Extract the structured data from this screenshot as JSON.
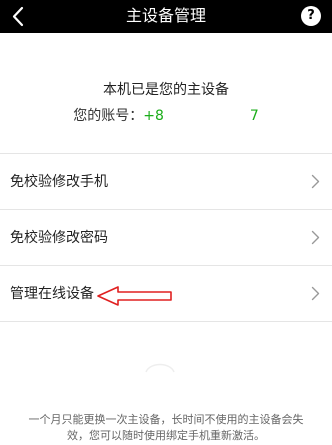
{
  "topbar": {
    "title": "主设备管理",
    "back_icon": "chevron-left-icon",
    "help_label": "?",
    "background": "#000000"
  },
  "info": {
    "heading": "本机已是您的主设备",
    "account_label": "您的账号：",
    "account_prefix": "+8",
    "account_suffix": "7",
    "account_color": "#1aad19"
  },
  "menu": {
    "items": [
      {
        "label": "免校验修改手机"
      },
      {
        "label": "免校验修改密码"
      },
      {
        "label": "管理在线设备"
      }
    ],
    "chevron_icon": "chevron-right-icon"
  },
  "annotation": {
    "arrow_color": "#e02020"
  },
  "footer": {
    "line1": "一个月只能更换一次主设备，长时间不使用的主设备会失",
    "line2": "效，您可以随时使用绑定手机重新激活。"
  }
}
